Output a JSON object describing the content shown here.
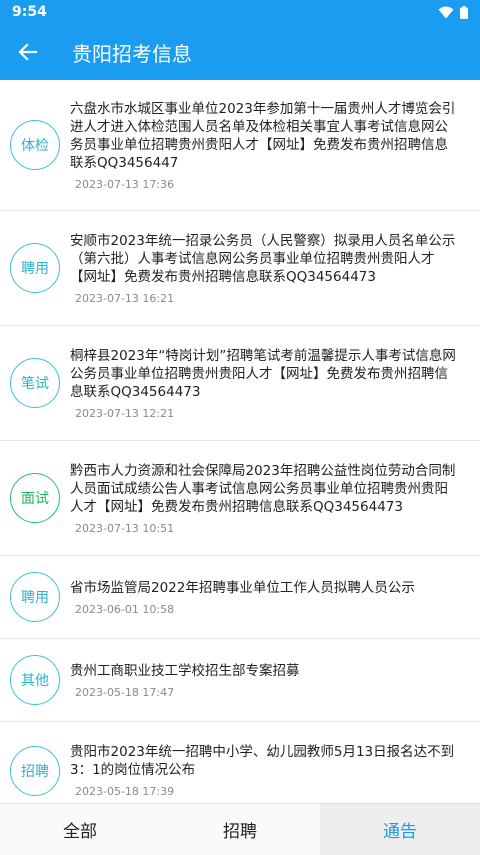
{
  "status": {
    "time": "9:54"
  },
  "app_bar": {
    "title": "贵阳招考信息"
  },
  "items": [
    {
      "badge": "体检",
      "title": "六盘水市水城区事业单位2023年参加第十一届贵州人才博览会引进人才进入体检范围人员名单及体检相关事宜人事考试信息网公务员事业单位招聘贵州贵阳人才【网址】免费发布贵州招聘信息联系QQ3456447",
      "date": "2023-07-13 17:36"
    },
    {
      "badge": "聘用",
      "title": "安顺市2023年统一招录公务员（人民警察）拟录用人员名单公示（第六批）人事考试信息网公务员事业单位招聘贵州贵阳人才【网址】免费发布贵州招聘信息联系QQ34564473",
      "date": "2023-07-13 16:21"
    },
    {
      "badge": "笔试",
      "title": "桐梓县2023年“特岗计划”招聘笔试考前温馨提示人事考试信息网公务员事业单位招聘贵州贵阳人才【网址】免费发布贵州招聘信息联系QQ34564473",
      "date": "2023-07-13 12:21"
    },
    {
      "badge": "面试",
      "title": "黔西市人力资源和社会保障局2023年招聘公益性岗位劳动合同制人员面试成绩公告人事考试信息网公务员事业单位招聘贵州贵阳人才【网址】免费发布贵州招聘信息联系QQ34564473",
      "date": "2023-07-13 10:51"
    },
    {
      "badge": "聘用",
      "title": "省市场监管局2022年招聘事业单位工作人员拟聘人员公示",
      "date": "2023-06-01 10:58"
    },
    {
      "badge": "其他",
      "title": "贵州工商职业技工学校招生部专案招募",
      "date": "2023-05-18 17:47"
    },
    {
      "badge": "招聘",
      "title": "贵阳市2023年统一招聘中小学、幼儿园教师5月13日报名达不到3：1的岗位情况公布",
      "date": "2023-05-18 17:39"
    }
  ],
  "bottom_nav": {
    "all": "全部",
    "recruit": "招聘",
    "notice": "通告",
    "active": "通告"
  }
}
